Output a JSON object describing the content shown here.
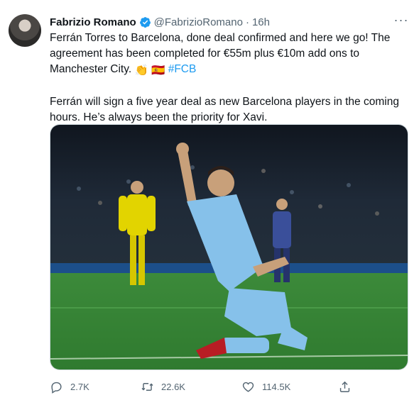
{
  "author": {
    "name": "Fabrizio Romano",
    "handle": "@FabrizioRomano",
    "separator": "·",
    "time": "16h"
  },
  "more_label": "···",
  "tweet": {
    "line1": "Ferrán Torres to Barcelona, done deal confirmed and here we go! The agreement has been completed for €55m plus €10m add ons to Manchester City. ",
    "emoji1": "👏",
    "emoji2": "🇪🇸",
    "hashtag": "#FCB",
    "paragraph2": "Ferrán will sign a five year deal as new Barcelona players in the coming hours. He’s always been the priority for Xavi."
  },
  "actions": {
    "replies": "2.7K",
    "retweets": "22.6K",
    "likes": "114.5K"
  },
  "colors": {
    "link": "#1d9bf0",
    "muted": "#536471",
    "verified": "#1d9bf0"
  }
}
